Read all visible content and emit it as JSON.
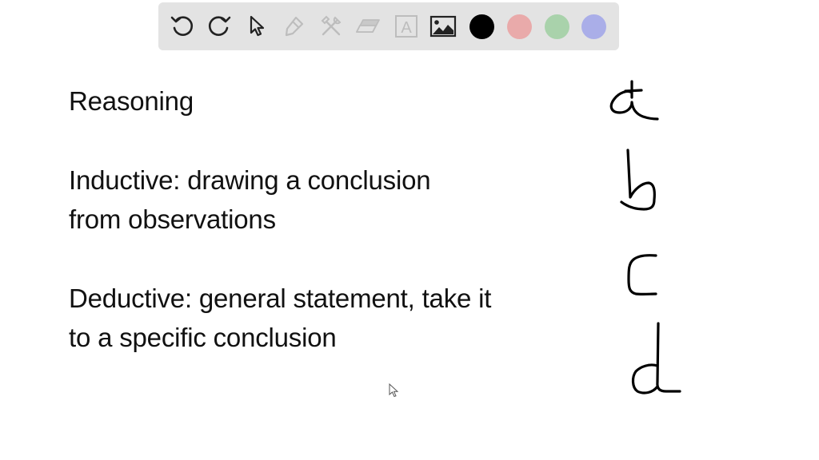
{
  "toolbar": {
    "tools": [
      {
        "name": "undo",
        "icon": "undo-icon",
        "enabled": true
      },
      {
        "name": "redo",
        "icon": "redo-icon",
        "enabled": true
      },
      {
        "name": "select",
        "icon": "pointer-icon",
        "enabled": true
      },
      {
        "name": "pen",
        "icon": "pen-icon",
        "enabled": false
      },
      {
        "name": "tools",
        "icon": "hammer-wrench-icon",
        "enabled": false
      },
      {
        "name": "eraser",
        "icon": "eraser-icon",
        "enabled": false
      },
      {
        "name": "text",
        "icon": "text-box-icon",
        "label": "A",
        "enabled": false
      },
      {
        "name": "image",
        "icon": "image-icon",
        "enabled": true
      }
    ],
    "colors": [
      {
        "name": "black",
        "hex": "#000000",
        "selected": true
      },
      {
        "name": "red",
        "hex": "#e9aaaa"
      },
      {
        "name": "green",
        "hex": "#a9d2ab"
      },
      {
        "name": "blue",
        "hex": "#aaaee8"
      }
    ]
  },
  "notes": {
    "title": "Reasoning",
    "inductive_line1": "Inductive: drawing a conclusion",
    "inductive_line2": "from observations",
    "deductive_line1": "Deductive: general statement, take it",
    "deductive_line2": "to a specific conclusion"
  },
  "handwritten_letters": [
    "a",
    "b",
    "c",
    "d"
  ],
  "ink_color": "#000000"
}
